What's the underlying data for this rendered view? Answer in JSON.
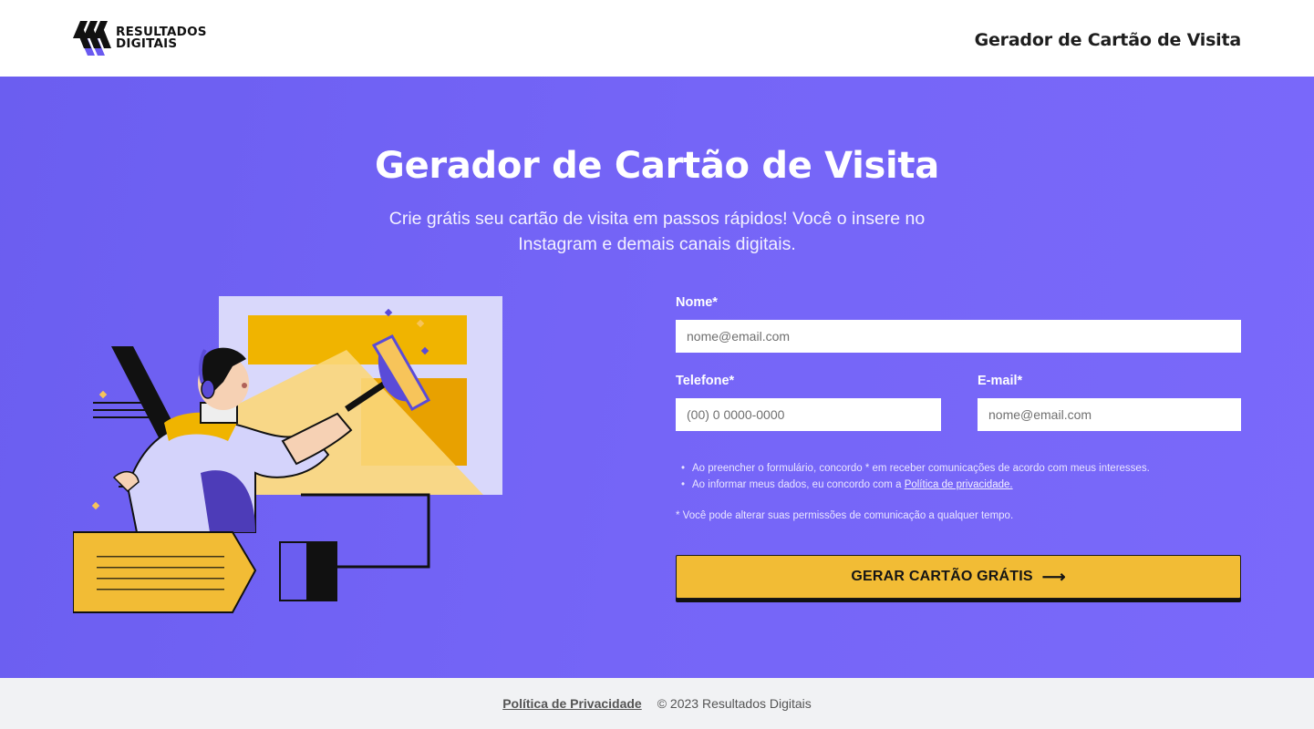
{
  "header": {
    "logo_line1": "RESULTADOS",
    "logo_line2": "DIGITAIS",
    "title": "Gerador de Cartão de Visita"
  },
  "hero": {
    "title": "Gerador de Cartão de Visita",
    "subtitle": "Crie grátis seu cartão de visita em passos rápidos! Você o insere no Instagram e demais canais digitais."
  },
  "form": {
    "name_label": "Nome*",
    "name_placeholder": "nome@email.com",
    "phone_label": "Telefone*",
    "phone_placeholder": "(00) 0 0000-0000",
    "email_label": "E-mail*",
    "email_placeholder": "nome@email.com",
    "consent_1": "Ao preencher o formulário, concordo * em receber comunicações de acordo com meus interesses.",
    "consent_2_prefix": "Ao informar meus dados, eu concordo com a ",
    "consent_2_link": "Política de privacidade.",
    "note": "* Você pode alterar suas permissões de comunicação a qualquer tempo.",
    "submit_label": "GERAR CARTÃO GRÁTIS",
    "submit_icon": "arrow-right-icon"
  },
  "footer": {
    "privacy_link": "Política de Privacidade",
    "copyright": "© 2023 Resultados Digitais"
  },
  "colors": {
    "hero_bg": "#7565f7",
    "button": "#f2bc35",
    "footer_bg": "#f1f2f4"
  }
}
